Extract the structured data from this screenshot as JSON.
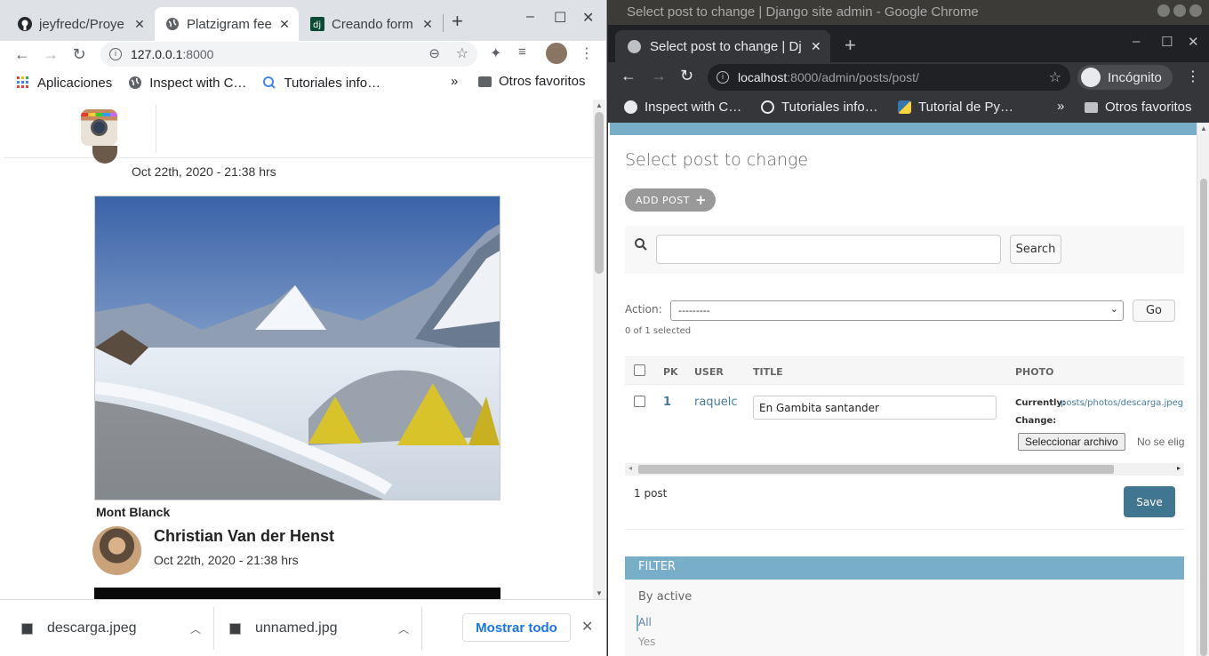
{
  "left_window": {
    "tabs": [
      {
        "title": "jeyfredc/Proye"
      },
      {
        "title": "Platzigram fee"
      },
      {
        "title": "Creando form"
      }
    ],
    "new_tab": "+",
    "window_controls": {
      "minimize": "–",
      "maximize": "☐",
      "close": "✕"
    },
    "url_host": "127.0.0.1",
    "url_port": ":8000",
    "bookmarks": [
      {
        "label": "Aplicaciones",
        "icon": "apps-grid-icon"
      },
      {
        "label": "Inspect with C…",
        "icon": "globe-icon"
      },
      {
        "label": "Tutoriales info…",
        "icon": "search-bookmark-icon"
      }
    ],
    "bookmarks_overflow": "»",
    "other_bookmarks": "Otros favoritos",
    "feed": {
      "post1_date": "Oct 22th, 2020 - 21:38 hrs",
      "post1_title": "Mont Blanck",
      "post2_author": "Christian Van der Henst",
      "post2_date": "Oct 22th, 2020 - 21:38 hrs"
    },
    "downloads": [
      {
        "name": "descarga.jpeg"
      },
      {
        "name": "unnamed.jpg"
      }
    ],
    "show_all": "Mostrar todo",
    "accent": "#1a73e8"
  },
  "right_window": {
    "window_title": "Select post to change | Django site admin - Google Chrome",
    "tab_title": "Select post to change | Dj",
    "url_host": "localhost",
    "url_path": ":8000/admin/posts/post/",
    "profile_label": "Incógnito",
    "bookmarks": [
      {
        "label": "Inspect with C…"
      },
      {
        "label": "Tutoriales info…"
      },
      {
        "label": "Tutorial de Py…"
      }
    ],
    "bookmarks_overflow": "»",
    "other_bookmarks": "Otros favoritos",
    "admin": {
      "page_title": "Select post to change",
      "add_button": "ADD POST",
      "search_button": "Search",
      "search_value": "",
      "action_label": "Action:",
      "action_selected": "---------",
      "go_button": "Go",
      "selected_count": "0 of 1 selected",
      "columns": [
        "PK",
        "USER",
        "TITLE",
        "PHOTO"
      ],
      "rows": [
        {
          "pk": "1",
          "user": "raquelc",
          "title": "En Gambita santander",
          "currently_label": "Currently:",
          "photo_path": "posts/photos/descarga.jpeg",
          "change_label": "Change:",
          "file_button": "Seleccionar archivo",
          "no_file": "No se eligió"
        }
      ],
      "result_count": "1 post",
      "save_button": "Save",
      "filter_header": "FILTER",
      "filter_group": "By active",
      "filter_options": [
        "All",
        "Yes"
      ],
      "primary_color": "#79aec8",
      "save_color": "#417690",
      "link_color": "#447e9b"
    }
  }
}
